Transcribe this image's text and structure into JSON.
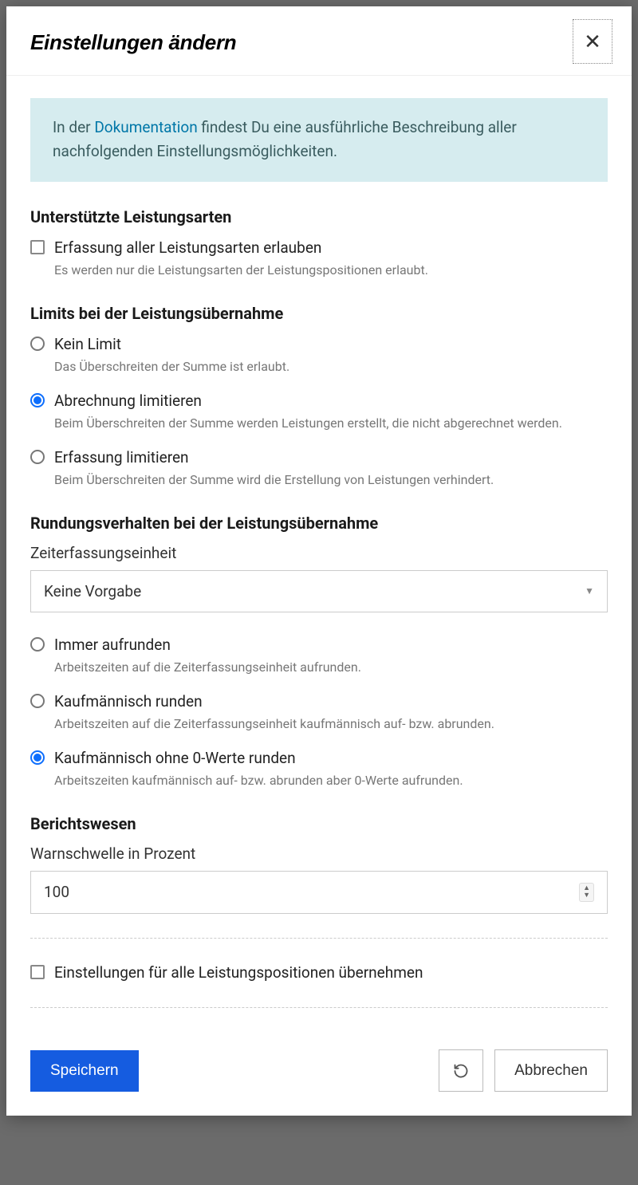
{
  "modal": {
    "title": "Einstellungen ändern"
  },
  "info": {
    "prefix": "In der ",
    "link": "Dokumentation",
    "suffix": " findest Du eine ausführliche Beschreibung aller nachfolgenden Einstellungsmöglichkeiten."
  },
  "sections": {
    "supported": {
      "title": "Unterstützte Leistungsarten",
      "allow_all": {
        "label": "Erfassung aller Leistungsarten erlauben",
        "desc": "Es werden nur die Leistungsarten der Leistungspositionen erlaubt.",
        "checked": false
      }
    },
    "limits": {
      "title": "Limits bei der Leistungsübernahme",
      "options": [
        {
          "label": "Kein Limit",
          "desc": "Das Überschreiten der Summe ist erlaubt.",
          "checked": false
        },
        {
          "label": "Abrechnung limitieren",
          "desc": "Beim Überschreiten der Summe werden Leistungen erstellt, die nicht abgerechnet werden.",
          "checked": true
        },
        {
          "label": "Erfassung limitieren",
          "desc": "Beim Überschreiten der Summe wird die Erstellung von Leistungen verhindert.",
          "checked": false
        }
      ]
    },
    "rounding": {
      "title": "Rundungsverhalten bei der Leistungsübernahme",
      "unit_label": "Zeiterfassungseinheit",
      "unit_value": "Keine Vorgabe",
      "options": [
        {
          "label": "Immer aufrunden",
          "desc": "Arbeitszeiten auf die Zeiterfassungseinheit aufrunden.",
          "checked": false
        },
        {
          "label": "Kaufmännisch runden",
          "desc": "Arbeitszeiten auf die Zeiterfassungseinheit kaufmännisch auf- bzw. abrunden.",
          "checked": false
        },
        {
          "label": "Kaufmännisch ohne 0-Werte runden",
          "desc": "Arbeitszeiten kaufmännisch auf- bzw. abrunden aber 0-Werte aufrunden.",
          "checked": true
        }
      ]
    },
    "reporting": {
      "title": "Berichtswesen",
      "threshold_label": "Warnschwelle in Prozent",
      "threshold_value": "100"
    },
    "apply_all": {
      "label": "Einstellungen für alle Leistungspositionen übernehmen",
      "checked": false
    }
  },
  "footer": {
    "save": "Speichern",
    "cancel": "Abbrechen"
  }
}
